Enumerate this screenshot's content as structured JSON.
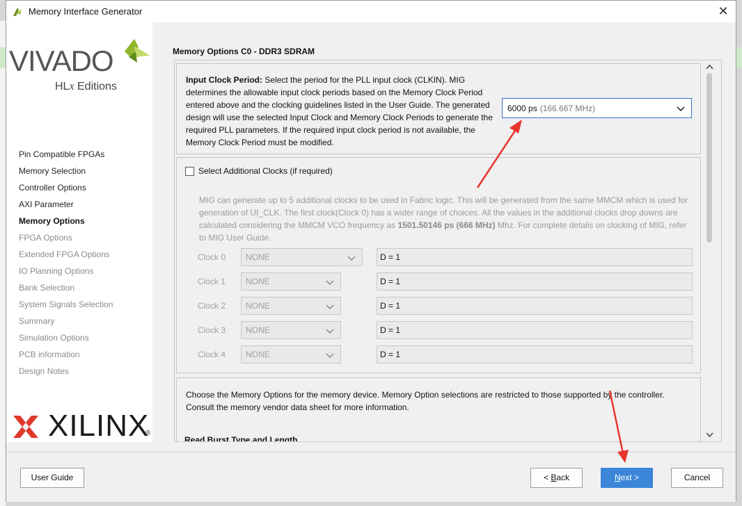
{
  "window": {
    "title": "Memory Interface Generator",
    "close_glyph": "✕"
  },
  "branding": {
    "vivado": "VIVADO",
    "hlx_prefix": "HL",
    "hlx_italic": "x",
    "hlx_suffix": " Editions",
    "xilinx": "XILINX",
    "registered": "®"
  },
  "sidebar": {
    "items": [
      {
        "label": "Pin Compatible FPGAs",
        "state": "done"
      },
      {
        "label": "Memory Selection",
        "state": "done"
      },
      {
        "label": "Controller Options",
        "state": "done"
      },
      {
        "label": "AXI Parameter",
        "state": "done"
      },
      {
        "label": "Memory Options",
        "state": "current"
      },
      {
        "label": "FPGA Options",
        "state": "pending"
      },
      {
        "label": "Extended FPGA Options",
        "state": "pending"
      },
      {
        "label": "IO Planning Options",
        "state": "pending"
      },
      {
        "label": "Bank Selection",
        "state": "pending"
      },
      {
        "label": "System Signals Selection",
        "state": "pending"
      },
      {
        "label": "Summary",
        "state": "pending"
      },
      {
        "label": "Simulation Options",
        "state": "pending"
      },
      {
        "label": "PCB information",
        "state": "pending"
      },
      {
        "label": "Design Notes",
        "state": "pending"
      }
    ]
  },
  "main": {
    "section_title": "Memory Options C0 - DDR3 SDRAM",
    "input_clock": {
      "label": "Input Clock Period:",
      "description": " Select the period for the PLL input clock (CLKIN). MIG determines the allowable input clock periods based on the Memory Clock Period entered above and the clocking guidelines listed in the User Guide. The generated design will use the selected Input Clock and Memory Clock Periods to generate the required PLL parameters. If the required input clock period is not available, the Memory Clock Period must be modified.",
      "value": "6000 ps",
      "value_hint": "(166.667 MHz)"
    },
    "additional_clocks": {
      "checkbox_label": "Select Additional Clocks (if required)",
      "checked": false,
      "desc_part1": "MIG can generate up to 5 additional clocks to be used in Fabric logic. This will be generated from the same MMCM which is used for generation of UI_CLK. The first clock(Clock 0) has a wider range of choices. All the values in the additional clocks drop downs are calculated considering the MMCM VCO frequency as ",
      "desc_bold": "1501.50146 ps (666 MHz)",
      "desc_part2": " Mhz. For complete details on clocking of MIG, refer to MIG User Guide.",
      "rows": [
        {
          "label": "Clock 0",
          "value": "NONE",
          "divider": "D = 1"
        },
        {
          "label": "Clock 1",
          "value": "NONE",
          "divider": "D = 1"
        },
        {
          "label": "Clock 2",
          "value": "NONE",
          "divider": "D = 1"
        },
        {
          "label": "Clock 3",
          "value": "NONE",
          "divider": "D = 1"
        },
        {
          "label": "Clock 4",
          "value": "NONE",
          "divider": "D = 1"
        }
      ]
    },
    "memory_options": {
      "description": "Choose the Memory Options for the memory device. Memory Option selections are restricted to those supported by the controller. Consult the memory vendor data sheet for more information.",
      "subheading": "Read Burst Type and Length"
    }
  },
  "footer": {
    "user_guide": "User Guide",
    "back_prefix": "< ",
    "back_mnemonic": "B",
    "back_rest": "ack",
    "next_mnemonic": "N",
    "next_rest": "ext >",
    "cancel": "Cancel"
  },
  "colors": {
    "accent": "#3b86d8",
    "focus_border": "#2f6fd1",
    "annotation": "#e8352b"
  }
}
